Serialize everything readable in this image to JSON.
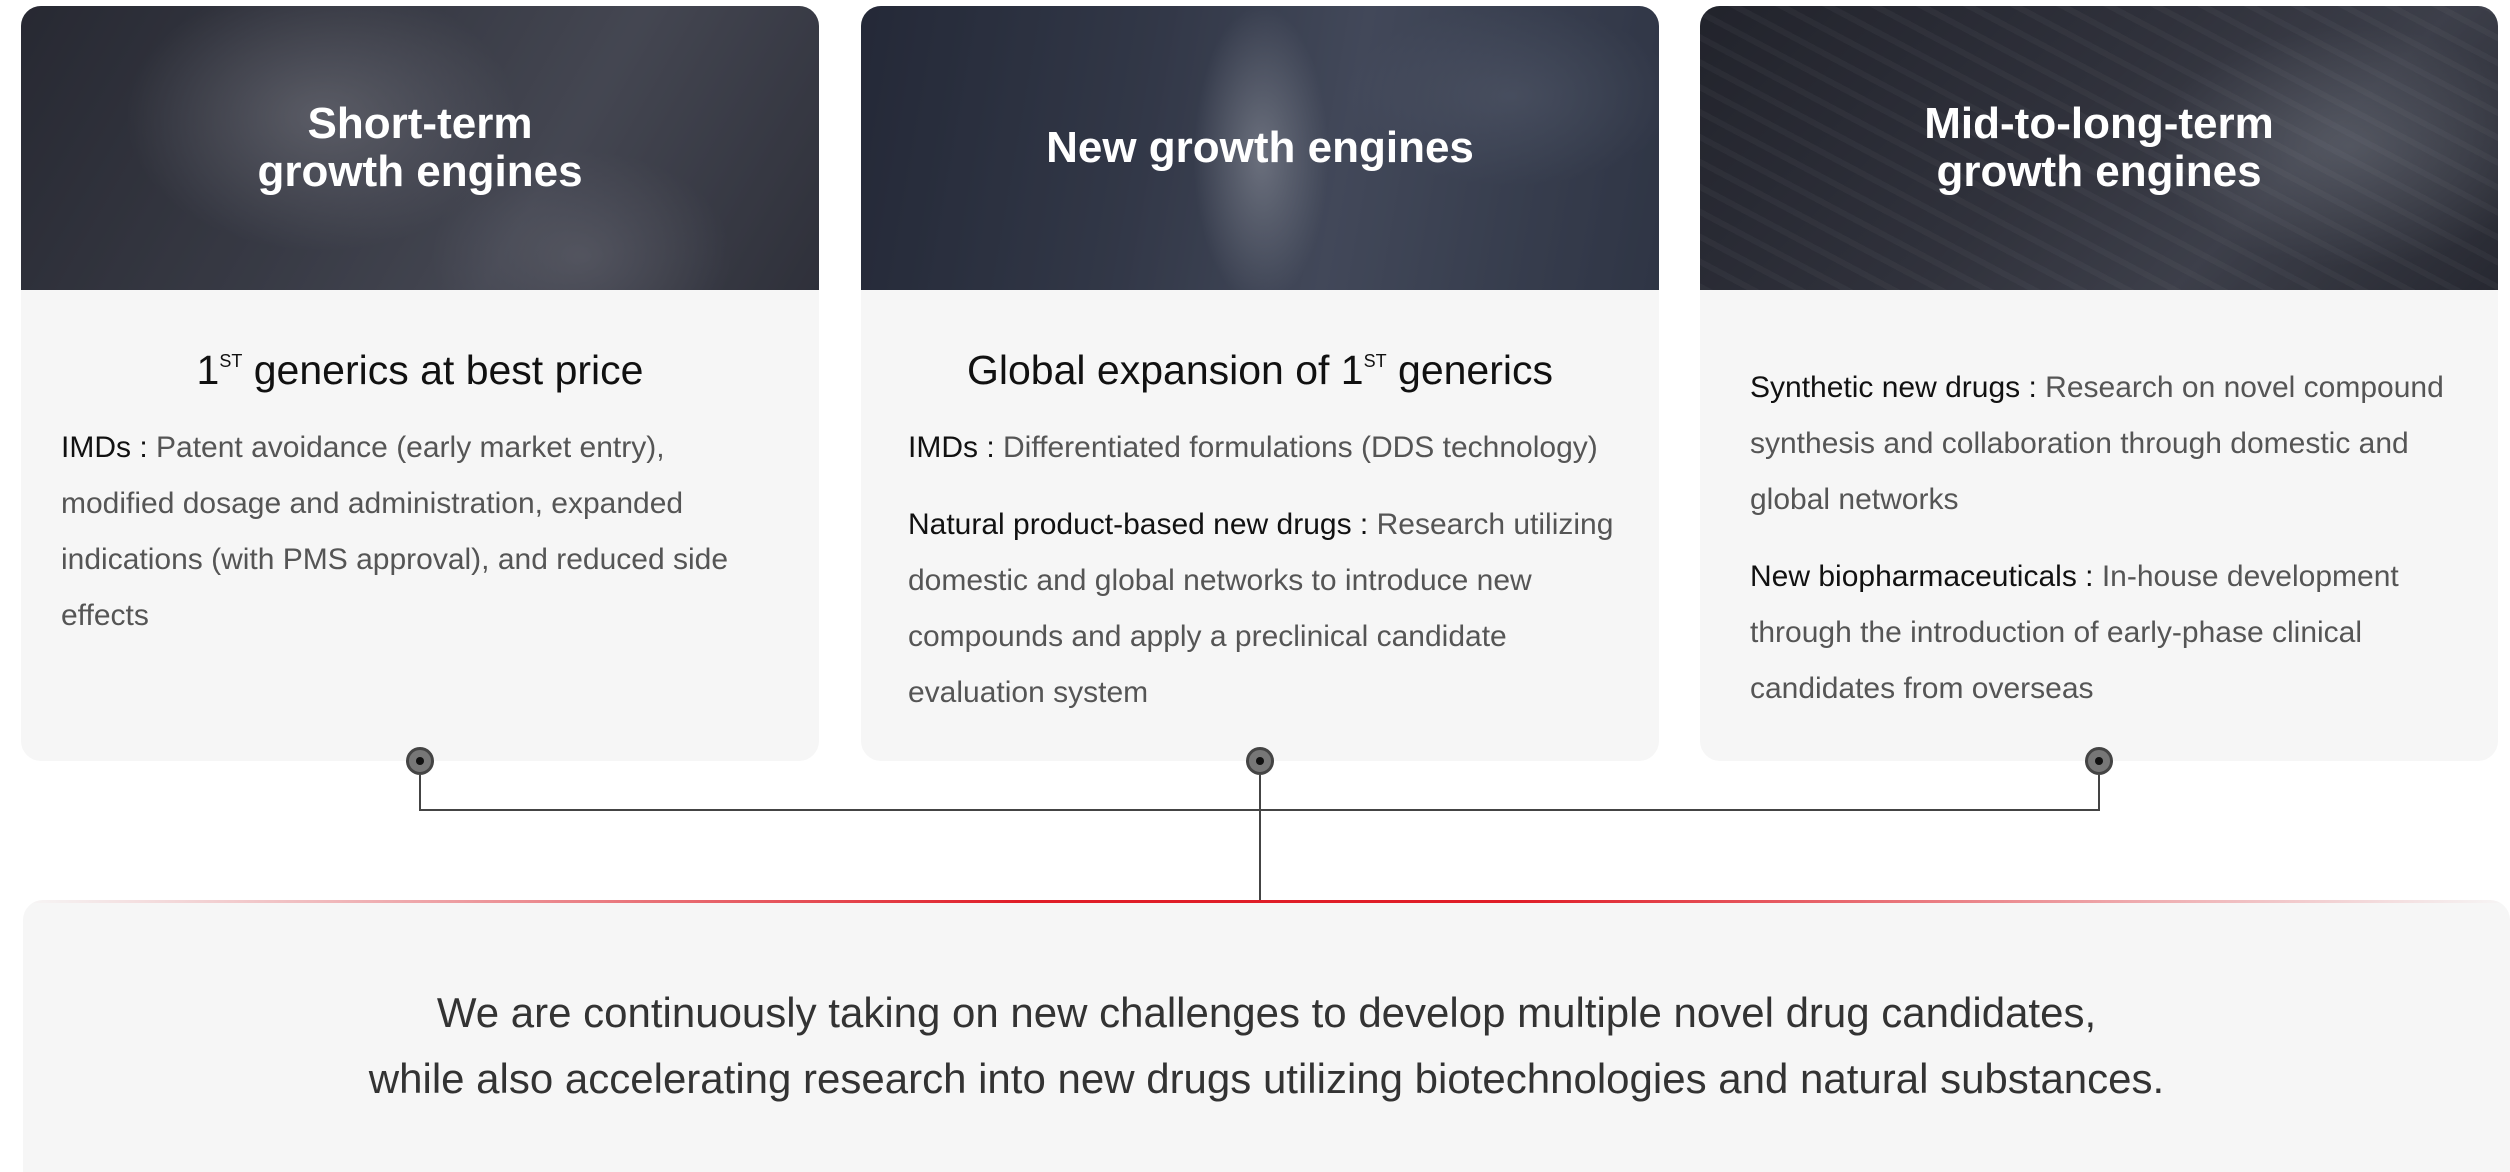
{
  "cards": [
    {
      "header_title": "Short-term\ngrowth engines",
      "subtitle": {
        "prefix": "1",
        "sup": "ST",
        "suffix": " generics at best price"
      },
      "items": [
        {
          "label": "IMDs",
          "sep": " : ",
          "text": "Patent avoidance (early market entry), modified dosage and administration, expanded indications (with PMS approval), and reduced side effects"
        }
      ]
    },
    {
      "header_title": "New growth engines",
      "subtitle": {
        "prefix": "Global expansion of 1",
        "sup": "ST",
        "suffix": " generics"
      },
      "items": [
        {
          "label": "IMDs",
          "sep": " : ",
          "text": "Differentiated formulations (DDS technology)"
        },
        {
          "label": "Natural product-based new drugs",
          "sep": " : ",
          "text": "Research utilizing domestic and global networks to introduce new compounds and apply a preclinical candidate evaluation system"
        }
      ]
    },
    {
      "header_title": "Mid-to-long-term\ngrowth engines",
      "items": [
        {
          "label": "Synthetic new drugs",
          "sep": " : ",
          "text": "Research on novel compound synthesis and collaboration through domestic and global networks"
        },
        {
          "label": "New biopharmaceuticals",
          "sep": " : ",
          "text": "In-house development through the introduction of early-phase clinical candidates from overseas"
        }
      ]
    }
  ],
  "summary": {
    "line1": "We are continuously taking on new challenges to develop multiple novel drug candidates,",
    "line2": "while also accelerating research into new drugs utilizing biotechnologies and natural substances."
  },
  "colors": {
    "accent_red": "#e01e28",
    "card_bg": "#f6f6f6",
    "connector": "#444444"
  }
}
